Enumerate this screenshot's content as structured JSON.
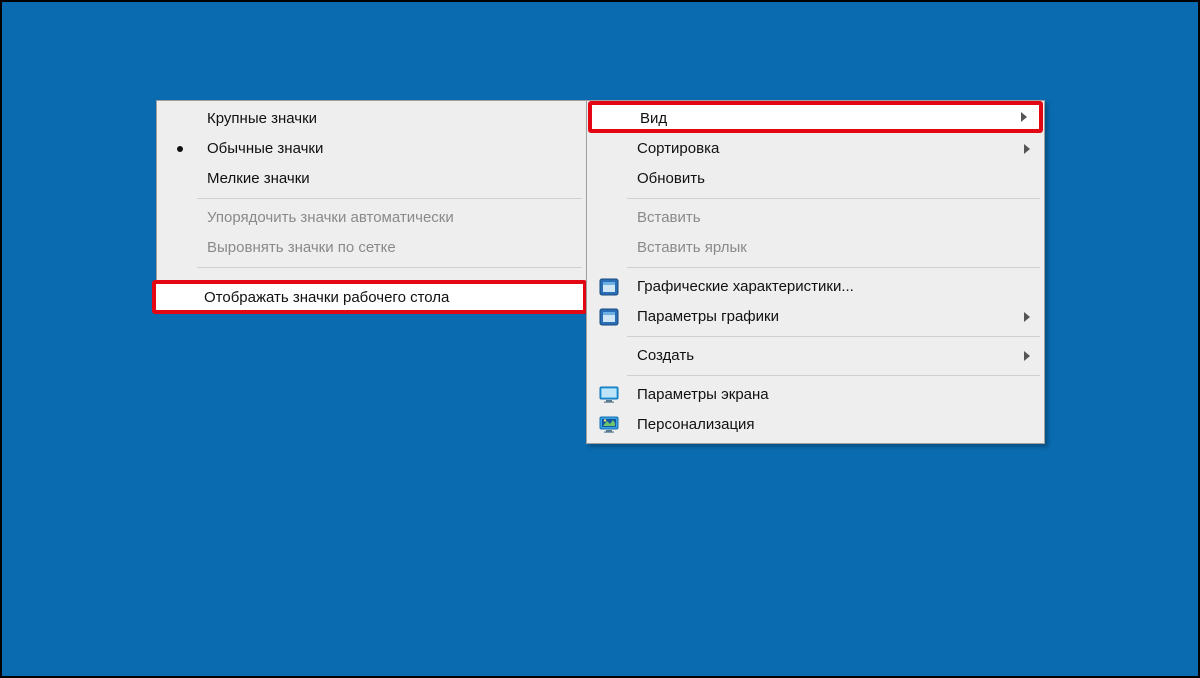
{
  "submenu": {
    "items": [
      {
        "label": "Крупные значки"
      },
      {
        "label": "Обычные значки",
        "selected": true
      },
      {
        "label": "Мелкие значки"
      }
    ],
    "arrange_auto": "Упорядочить значки автоматически",
    "align_grid": "Выровнять значки по сетке",
    "show_desktop_icons": "Отображать значки рабочего стола"
  },
  "mainmenu": {
    "view": "Вид",
    "sort": "Сортировка",
    "refresh": "Обновить",
    "paste": "Вставить",
    "paste_shortcut": "Вставить ярлык",
    "gfx_props": "Графические характеристики...",
    "gfx_params": "Параметры графики",
    "new": "Создать",
    "display_settings": "Параметры экрана",
    "personalize": "Персонализация"
  }
}
